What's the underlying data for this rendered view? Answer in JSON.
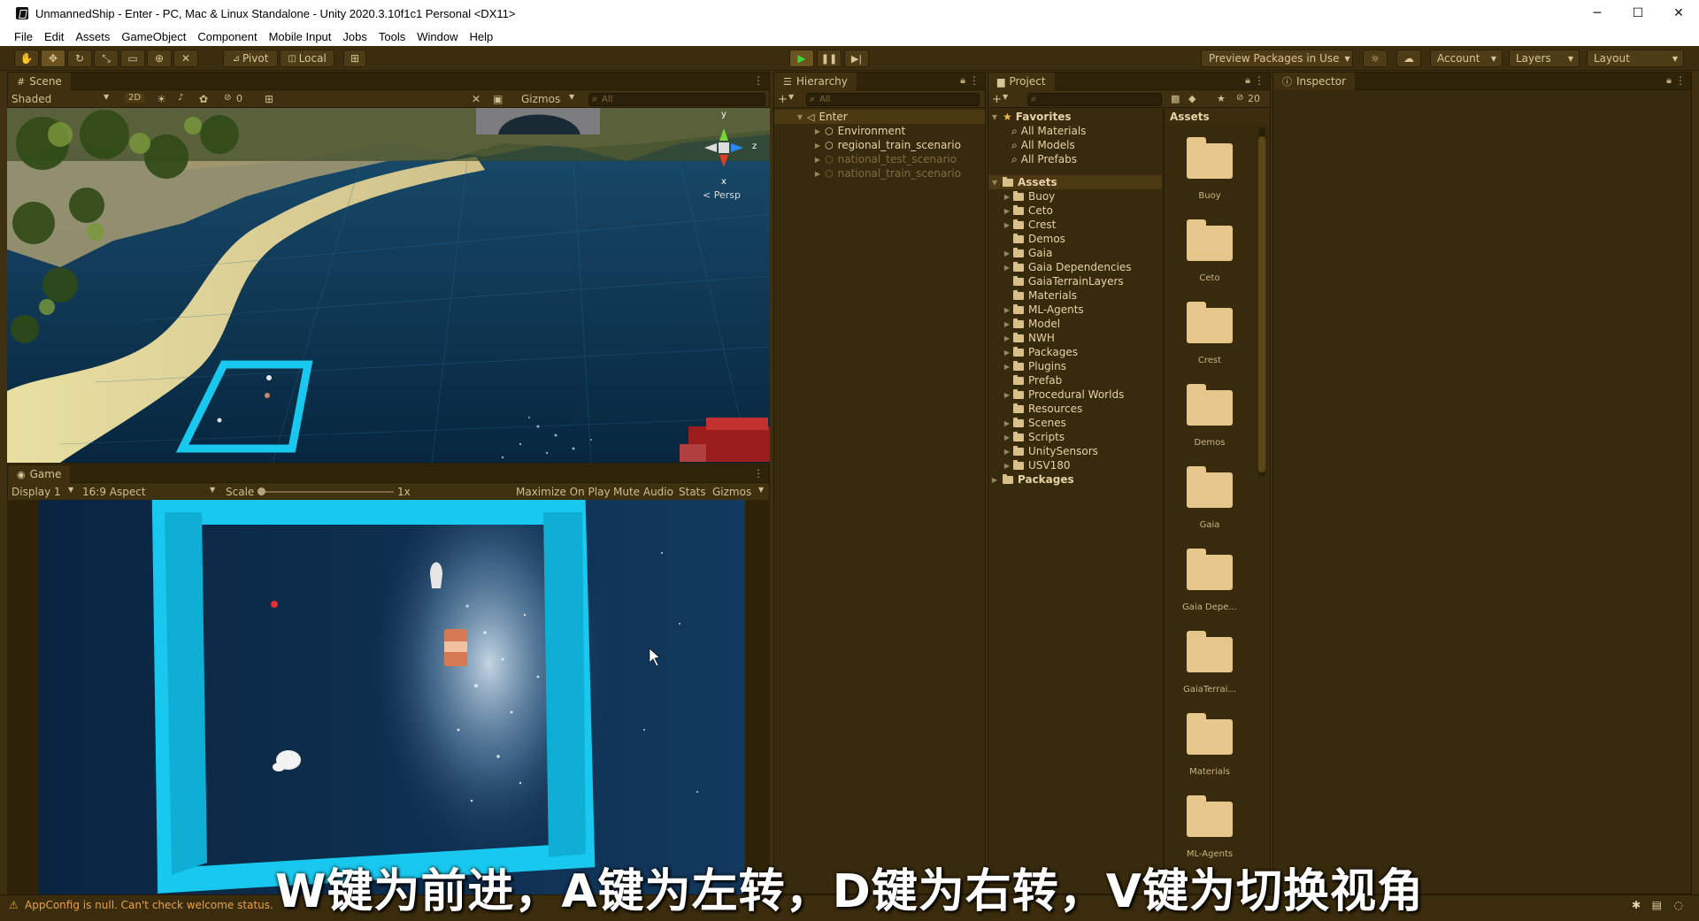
{
  "window": {
    "title": "UnmannedShip - Enter - PC, Mac & Linux Standalone - Unity 2020.3.10f1c1 Personal <DX11>",
    "min": "─",
    "max": "☐",
    "close": "✕"
  },
  "menu": [
    "File",
    "Edit",
    "Assets",
    "GameObject",
    "Component",
    "Mobile Input",
    "Jobs",
    "Tools",
    "Window",
    "Help"
  ],
  "toolbar": {
    "pivot": "Pivot",
    "local": "Local",
    "preview": "Preview Packages in Use",
    "account": "Account",
    "layers": "Layers",
    "layout": "Layout"
  },
  "scene": {
    "tab": "Scene",
    "shading": "Shaded",
    "mode2d": "2D",
    "hidden_count": "0",
    "gizmos": "Gizmos",
    "search_placeholder": "All",
    "persp": "< Persp",
    "axis_y": "y",
    "axis_z": "z",
    "axis_x": "x"
  },
  "game": {
    "tab": "Game",
    "display": "Display 1",
    "aspect": "16:9 Aspect",
    "scale_label": "Scale",
    "scale_value": "1x",
    "maximize": "Maximize On Play",
    "mute": "Mute Audio",
    "stats": "Stats",
    "gizmos": "Gizmos"
  },
  "hierarchy": {
    "tab": "Hierarchy",
    "search_placeholder": "All",
    "scene": "Enter",
    "items": [
      {
        "label": "Environment",
        "dim": false
      },
      {
        "label": "regional_train_scenario",
        "dim": false
      },
      {
        "label": "national_test_scenario",
        "dim": true
      },
      {
        "label": "national_train_scenario",
        "dim": true
      }
    ]
  },
  "project": {
    "tab": "Project",
    "hidden_count": "20",
    "favorites": "Favorites",
    "fav_items": [
      "All Materials",
      "All Models",
      "All Prefabs"
    ],
    "assets_root": "Assets",
    "folders": [
      "Buoy",
      "Ceto",
      "Crest",
      "Demos",
      "Gaia",
      "Gaia Dependencies",
      "GaiaTerrainLayers",
      "Materials",
      "ML-Agents",
      "Model",
      "NWH",
      "Packages",
      "Plugins",
      "Prefab",
      "Procedural Worlds",
      "Resources",
      "Scenes",
      "Scripts",
      "UnitySensors",
      "USV180"
    ],
    "packages": "Packages",
    "grid_header": "Assets",
    "grid_items": [
      "Buoy",
      "Ceto",
      "Crest",
      "Demos",
      "Gaia",
      "Gaia Depe...",
      "GaiaTerrai...",
      "Materials",
      "ML-Agents"
    ]
  },
  "inspector": {
    "tab": "Inspector"
  },
  "status": {
    "message": "AppConfig is null. Can't check welcome status."
  },
  "subtitle": "W键为前进，A键为左转，D键为右转，V键为切换视角",
  "colors": {
    "accent_cyan": "#19c8ee",
    "play_green": "#3cd43c",
    "panel_bg": "#382a0c"
  }
}
